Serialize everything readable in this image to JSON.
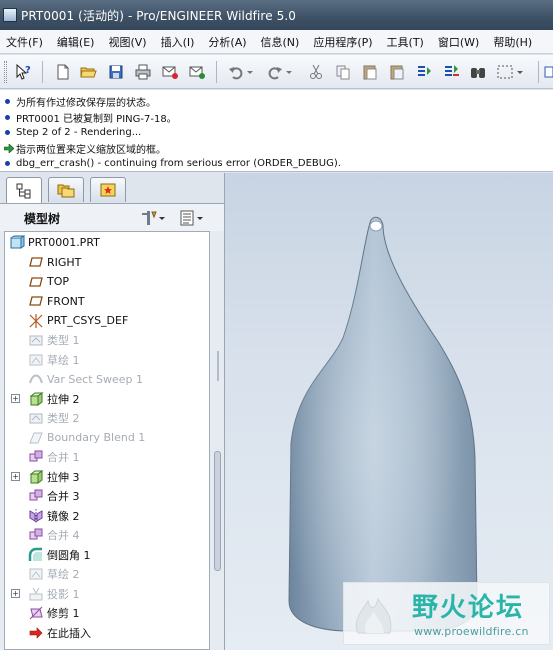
{
  "window": {
    "title": "PRT0001 (活动的) - Pro/ENGINEER Wildfire 5.0"
  },
  "menu": [
    "文件(F)",
    "编辑(E)",
    "视图(V)",
    "插入(I)",
    "分析(A)",
    "信息(N)",
    "应用程序(P)",
    "工具(T)",
    "窗口(W)",
    "帮助(H)"
  ],
  "messages": [
    {
      "icon": "bullet",
      "text": "为所有作过修改保存层的状态。"
    },
    {
      "icon": "bullet",
      "text": "PRT0001 已被复制到 PING-7-18。"
    },
    {
      "icon": "bullet",
      "text": "Step 2 of 2 - Rendering..."
    },
    {
      "icon": "arrow",
      "text": "指示两位置来定义缩放区域的框。"
    },
    {
      "icon": "bullet",
      "text": "dbg_err_crash() - continuing from serious error (ORDER_DEBUG)."
    }
  ],
  "navigator": {
    "tabs": [
      "model-tree-tab",
      "folder-browser-tab",
      "favorites-tab"
    ],
    "header": "模型树"
  },
  "tree": {
    "root": "PRT0001.PRT",
    "items": [
      {
        "label": "RIGHT",
        "icon": "datum-plane-icon",
        "dim": false,
        "expand": false
      },
      {
        "label": "TOP",
        "icon": "datum-plane-icon",
        "dim": false,
        "expand": false
      },
      {
        "label": "FRONT",
        "icon": "datum-plane-icon",
        "dim": false,
        "expand": false
      },
      {
        "label": "PRT_CSYS_DEF",
        "icon": "csys-icon",
        "dim": false,
        "expand": false
      },
      {
        "label": "类型 1",
        "icon": "feature-icon",
        "dim": true,
        "expand": false
      },
      {
        "label": "草绘 1",
        "icon": "sketch-icon",
        "dim": true,
        "expand": false
      },
      {
        "label": "Var Sect Sweep 1",
        "icon": "sweep-icon",
        "dim": true,
        "expand": false
      },
      {
        "label": "拉伸 2",
        "icon": "extrude-icon",
        "dim": false,
        "expand": true
      },
      {
        "label": "类型 2",
        "icon": "feature-icon",
        "dim": true,
        "expand": false
      },
      {
        "label": "Boundary Blend 1",
        "icon": "blend-icon",
        "dim": true,
        "expand": false
      },
      {
        "label": "合并 1",
        "icon": "merge-icon",
        "dim": true,
        "expand": false
      },
      {
        "label": "拉伸 3",
        "icon": "extrude-icon",
        "dim": false,
        "expand": true
      },
      {
        "label": "合并 3",
        "icon": "merge-icon",
        "dim": false,
        "expand": false
      },
      {
        "label": "镜像 2",
        "icon": "mirror-icon",
        "dim": false,
        "expand": false
      },
      {
        "label": "合并 4",
        "icon": "merge-icon",
        "dim": true,
        "expand": false
      },
      {
        "label": "倒圆角 1",
        "icon": "round-icon",
        "dim": false,
        "expand": false
      },
      {
        "label": "草绘 2",
        "icon": "sketch-icon",
        "dim": true,
        "expand": false
      },
      {
        "label": "投影 1",
        "icon": "project-icon",
        "dim": true,
        "expand": true
      },
      {
        "label": "修剪 1",
        "icon": "trim-icon",
        "dim": false,
        "expand": false
      },
      {
        "label": "在此插入",
        "icon": "insert-here-icon",
        "dim": false,
        "expand": false
      }
    ]
  },
  "watermark": {
    "title": "野火论坛",
    "url": "www.proewildfire.cn"
  },
  "colors": {
    "titlebar": "#3e5064",
    "model": "#9ab0c4",
    "message_bullet": "#1c3ea8",
    "watermark": "#2bb5a9"
  }
}
